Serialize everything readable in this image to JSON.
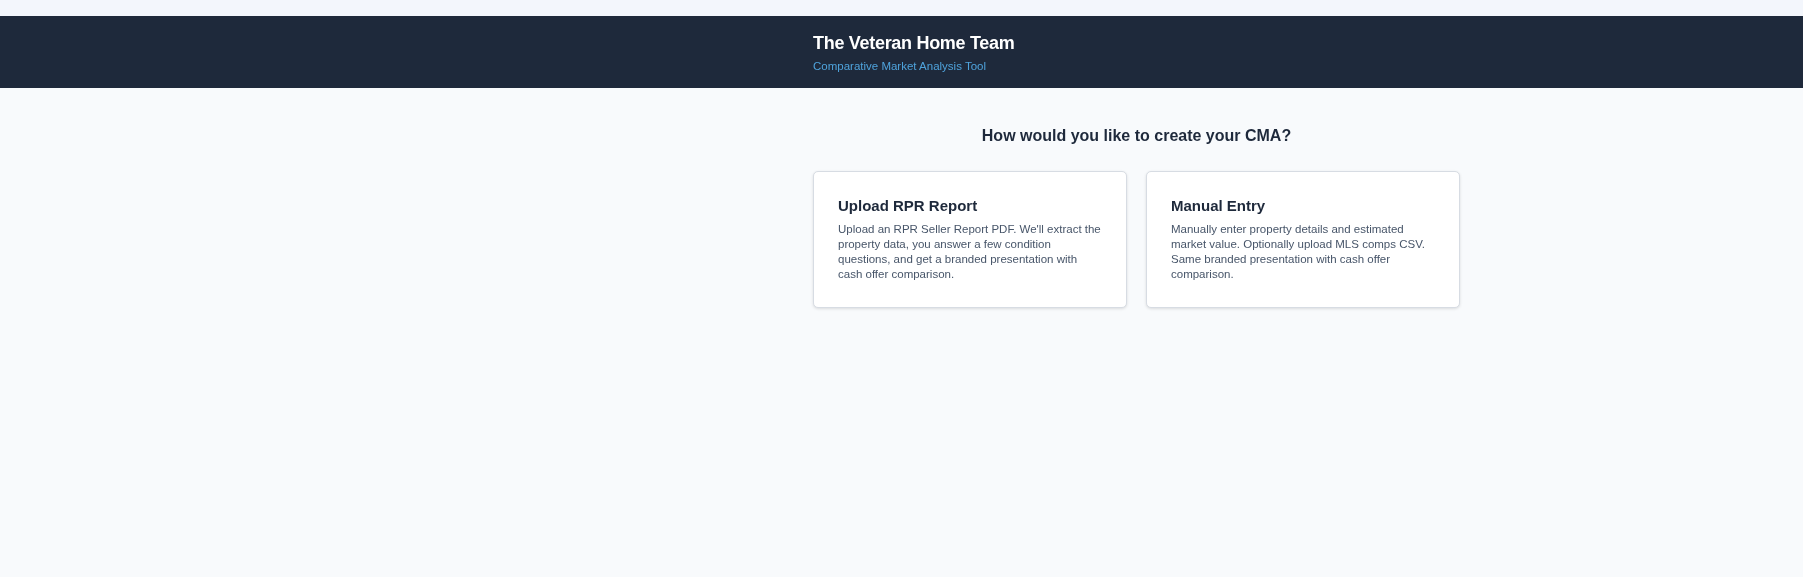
{
  "header": {
    "title": "The Veteran Home Team",
    "subtitle": "Comparative Market Analysis Tool"
  },
  "prompt": "How would you like to create your CMA?",
  "options": [
    {
      "title": "Upload RPR Report",
      "description": "Upload an RPR Seller Report PDF. We'll extract the property data, you answer a few condition questions, and get a branded presentation with cash offer comparison."
    },
    {
      "title": "Manual Entry",
      "description": "Manually enter property details and estimated market value. Optionally upload MLS comps CSV. Same branded presentation with cash offer comparison."
    }
  ]
}
